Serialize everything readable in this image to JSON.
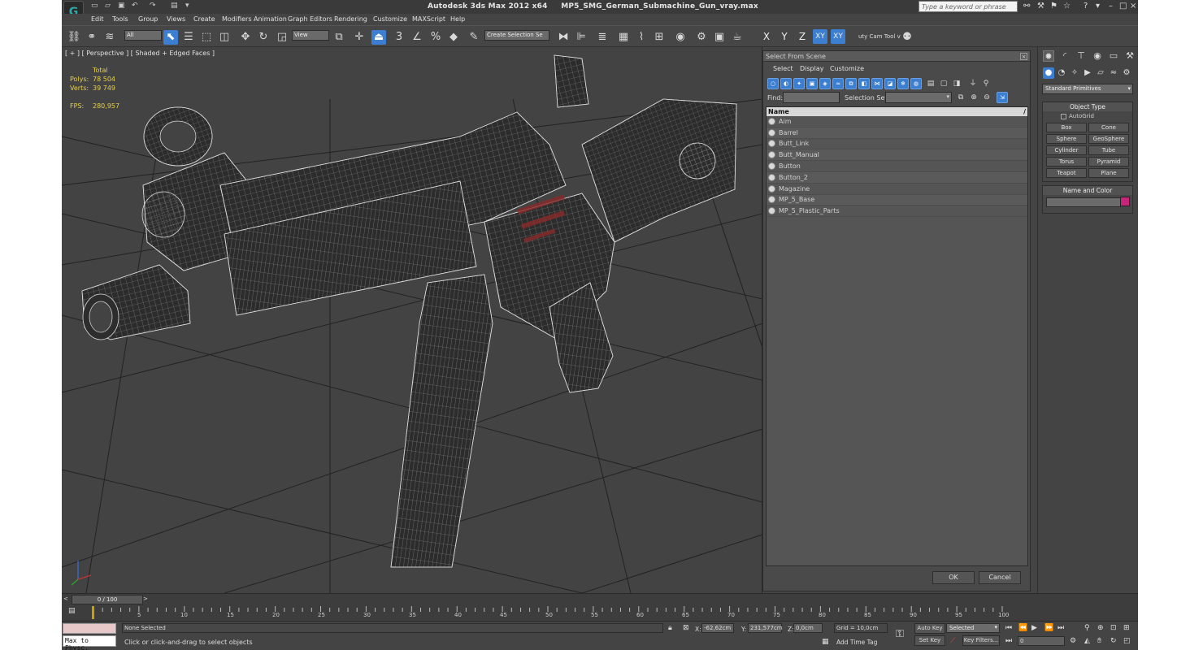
{
  "title": {
    "app": "Autodesk 3ds Max  2012 x64",
    "file": "MP5_SMG_German_Submachine_Gun_vray.max",
    "logo_glyph": "G",
    "search_placeholder": "Type a keyword or phrase"
  },
  "menu": [
    "Edit",
    "Tools",
    "Group",
    "Views",
    "Create",
    "Modifiers",
    "Animation",
    "Graph Editors",
    "Rendering",
    "Customize",
    "MAXScript",
    "Help"
  ],
  "toolbar": {
    "filter": "All",
    "ref_coord": "View",
    "selection_set": "Create Selection Se",
    "axis_x": "X",
    "axis_y": "Y",
    "axis_z": "Z",
    "axis_xy": "XY",
    "axis_xy2": "XY",
    "extra": "uty Cam Tool v",
    "snap_3": "3",
    "snap_angle": "∠",
    "snap_pct": "%",
    "snap_spin": "◆"
  },
  "viewport": {
    "label": "[ + ] [ Perspective ] [ Shaded + Edged Faces ]",
    "total_label": "Total",
    "polys_label": "Polys:",
    "polys": "78 504",
    "verts_label": "Verts:",
    "verts": "39 749",
    "fps_label": "FPS:",
    "fps": "280,957"
  },
  "dialog": {
    "title": "Select From Scene",
    "menu": [
      "Select",
      "Display",
      "Customize"
    ],
    "find_label": "Find:",
    "selection_set_label": "Selection Set:",
    "column_name": "Name",
    "items": [
      "Aim",
      "Barrel",
      "Butt_Link",
      "Butt_Manual",
      "Button",
      "Button_2",
      "Magazine",
      "MP_5_Base",
      "MP_5_Plastic_Parts"
    ],
    "ok": "OK",
    "cancel": "Cancel"
  },
  "command_panel": {
    "category": "Standard Primitives",
    "object_type_title": "Object Type",
    "autogrid": "AutoGrid",
    "objects": [
      "Box",
      "Cone",
      "Sphere",
      "GeoSphere",
      "Cylinder",
      "Tube",
      "Torus",
      "Pyramid",
      "Teapot",
      "Plane"
    ],
    "name_color_title": "Name and Color",
    "color": "#c72579"
  },
  "timeline": {
    "frame": "0 / 100",
    "ticks": [
      "5",
      "10",
      "15",
      "20",
      "25",
      "30",
      "35",
      "40",
      "45",
      "50",
      "55",
      "60",
      "65",
      "70",
      "75",
      "80",
      "85",
      "90",
      "95",
      "100"
    ]
  },
  "status": {
    "selection": "None Selected",
    "prompt": "Click or click-and-drag to select objects",
    "script": "Max to Physc.",
    "x_label": "X:",
    "x": "-62,62cm",
    "y_label": "Y:",
    "y": "231,577cm",
    "z_label": "Z:",
    "z": "0,0cm",
    "grid": "Grid = 10,0cm",
    "add_time_tag": "Add Time Tag",
    "auto_key": "Auto Key",
    "set_key": "Set Key",
    "key_mode": "Selected",
    "key_filters": "Key Filters...",
    "current_frame": "0"
  },
  "colors": {
    "accent": "#3c7fd0",
    "stats": "#e7d04a",
    "viewport_bg": "#434343",
    "wire_gun": "#cfcfcf",
    "wire_grid": "#1a1a1a"
  }
}
